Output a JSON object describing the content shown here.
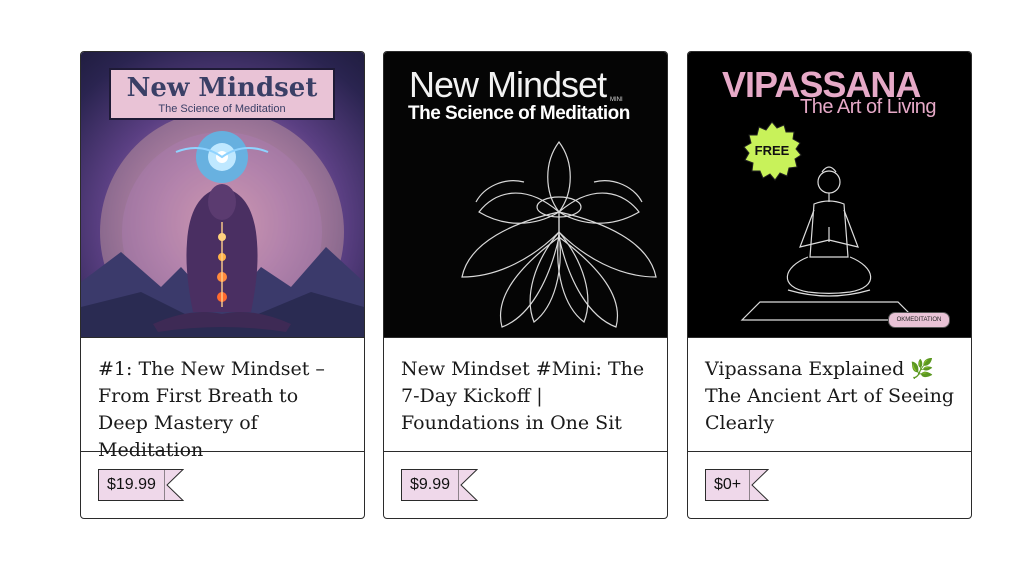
{
  "products": [
    {
      "cover": {
        "title": "New Mindset",
        "subtitle": "The Science of Meditation"
      },
      "title": "#1: The New Mindset – From First Breath to Deep Mastery of Meditation",
      "price": "$19.99"
    },
    {
      "cover": {
        "title": "New Mindset",
        "tag": "MINI",
        "subtitle": "The Science of Meditation"
      },
      "title": "New Mindset #Mini: The 7-Day Kickoff | Foundations in One Sit",
      "price": "$9.99"
    },
    {
      "cover": {
        "title": "VIPASSANA",
        "subtitle": "The Art of Living",
        "badge": "FREE",
        "handle": "OKMEDITATION"
      },
      "title": "Vipassana Explained 🌿 The Ancient Art of Seeing Clearly",
      "price": "$0+"
    }
  ],
  "colors": {
    "price_tag": "#efd8ea",
    "border": "#2b2b2b",
    "badge": "#c8f25a",
    "vipassana_pink": "#e6a9c7"
  }
}
